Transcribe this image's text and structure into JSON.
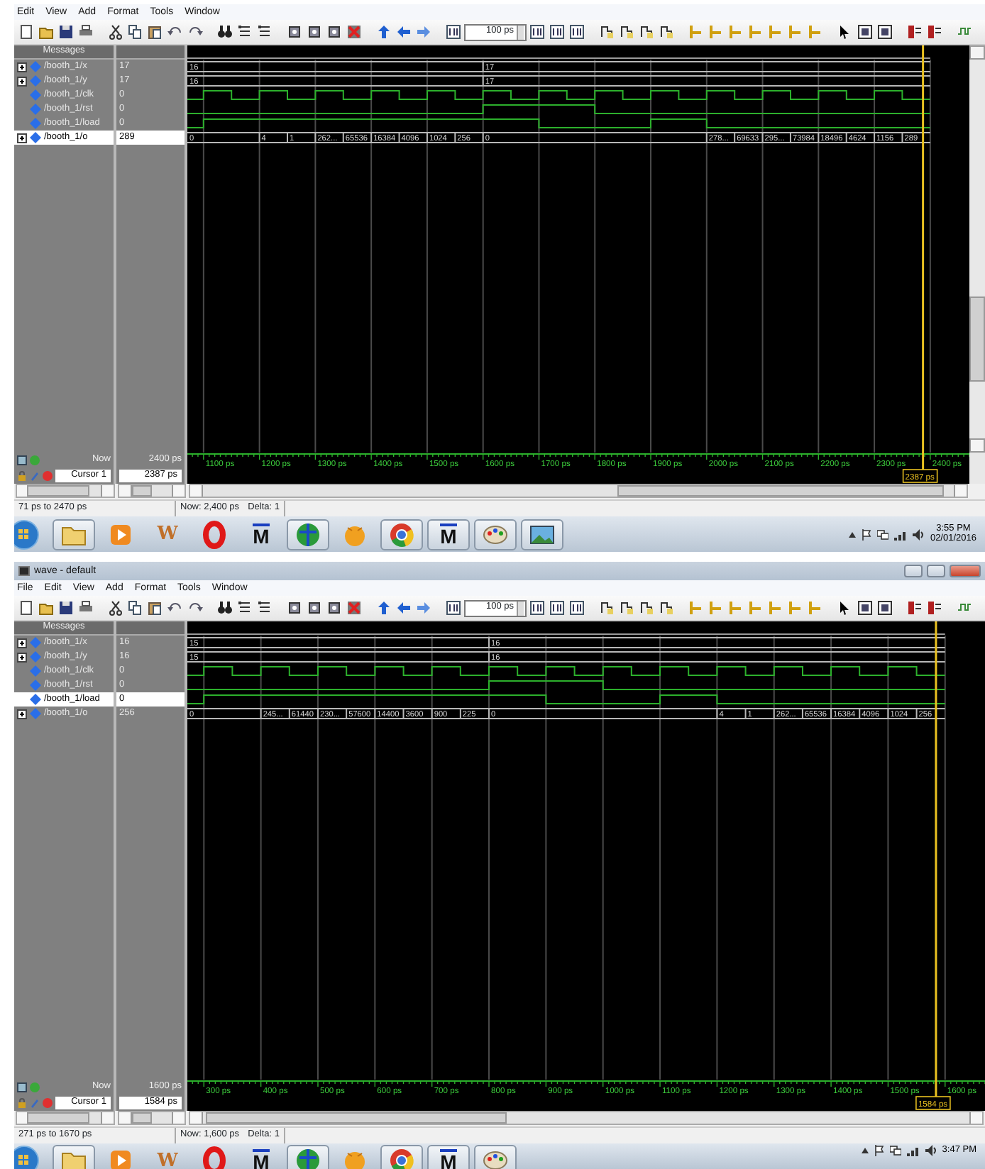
{
  "windows": [
    {
      "menu": [
        "Edit",
        "View",
        "Add",
        "Format",
        "Tools",
        "Window"
      ],
      "zoom_field": "100 ps",
      "messages_header": "Messages",
      "vertical_scrollbar": true,
      "signals": [
        {
          "name": "/booth_1/x",
          "value": "17",
          "kind": "bus",
          "expandable": true,
          "selected": false,
          "segments": [
            "16",
            "17"
          ]
        },
        {
          "name": "/booth_1/y",
          "value": "17",
          "kind": "bus",
          "expandable": true,
          "selected": false,
          "segments": [
            "16",
            "17"
          ]
        },
        {
          "name": "/booth_1/clk",
          "value": "0",
          "kind": "bit",
          "expandable": false,
          "selected": false
        },
        {
          "name": "/booth_1/rst",
          "value": "0",
          "kind": "bit",
          "expandable": false,
          "selected": false
        },
        {
          "name": "/booth_1/load",
          "value": "0",
          "kind": "bit",
          "expandable": false,
          "selected": false
        },
        {
          "name": "/booth_1/o",
          "value": "289",
          "kind": "bus",
          "expandable": true,
          "selected": true,
          "segments": [
            "0",
            "4",
            "1",
            "262...",
            "65536",
            "16384",
            "4096",
            "1024",
            "256",
            "0",
            "278...",
            "69633",
            "295...",
            "73984",
            "18496",
            "4624",
            "1156",
            "289"
          ]
        }
      ],
      "now": {
        "label": "Now",
        "value": "2400 ps"
      },
      "cursor": {
        "label": "Cursor 1",
        "value": "2387 ps",
        "flag": "2387 ps"
      },
      "ruler": [
        "1100 ps",
        "1200 ps",
        "1300 ps",
        "1400 ps",
        "1500 ps",
        "1600 ps",
        "1700 ps",
        "1800 ps",
        "1900 ps",
        "2000 ps",
        "2100 ps",
        "2200 ps",
        "2300 ps",
        "2400 ps"
      ],
      "status": {
        "range": "71 ps to 2470 ps",
        "now": "Now: 2,400 ps",
        "delta": "Delta: 1"
      },
      "taskbar": {
        "apps": [
          {
            "kind": "start",
            "running": false
          },
          {
            "kind": "folder",
            "running": true
          },
          {
            "kind": "media",
            "running": false
          },
          {
            "kind": "word",
            "label": "W",
            "running": false
          },
          {
            "kind": "opera",
            "running": false
          },
          {
            "kind": "modelsim",
            "label": "M",
            "running": false
          },
          {
            "kind": "globe",
            "running": true
          },
          {
            "kind": "ball",
            "running": false
          },
          {
            "kind": "chrome",
            "running": true
          },
          {
            "kind": "modelsim",
            "label": "M",
            "running": true
          },
          {
            "kind": "paint",
            "running": true
          },
          {
            "kind": "photo",
            "running": true
          }
        ],
        "time": "3:55 PM",
        "date": "02/01/2016"
      }
    },
    {
      "title": "wave - default",
      "menu": [
        "File",
        "Edit",
        "View",
        "Add",
        "Format",
        "Tools",
        "Window"
      ],
      "zoom_field": "100 ps",
      "messages_header": "Messages",
      "signals": [
        {
          "name": "/booth_1/x",
          "value": "16",
          "kind": "bus",
          "expandable": true,
          "selected": false,
          "segments": [
            "15",
            "16"
          ]
        },
        {
          "name": "/booth_1/y",
          "value": "16",
          "kind": "bus",
          "expandable": true,
          "selected": false,
          "segments": [
            "15",
            "16"
          ]
        },
        {
          "name": "/booth_1/clk",
          "value": "0",
          "kind": "bit",
          "expandable": false,
          "selected": false
        },
        {
          "name": "/booth_1/rst",
          "value": "0",
          "kind": "bit",
          "expandable": false,
          "selected": false
        },
        {
          "name": "/booth_1/load",
          "value": "0",
          "kind": "bit",
          "expandable": false,
          "selected": true
        },
        {
          "name": "/booth_1/o",
          "value": "256",
          "kind": "bus",
          "expandable": true,
          "selected": false,
          "segments": [
            "0",
            "245...",
            "61440",
            "230...",
            "57600",
            "14400",
            "3600",
            "900",
            "225",
            "0",
            "4",
            "1",
            "262...",
            "65536",
            "16384",
            "4096",
            "1024",
            "256"
          ]
        }
      ],
      "now": {
        "label": "Now",
        "value": "1600 ps"
      },
      "cursor": {
        "label": "Cursor 1",
        "value": "1584 ps",
        "flag": "1584 ps"
      },
      "ruler": [
        "300 ps",
        "400 ps",
        "500 ps",
        "600 ps",
        "700 ps",
        "800 ps",
        "900 ps",
        "1000 ps",
        "1100 ps",
        "1200 ps",
        "1300 ps",
        "1400 ps",
        "1500 ps",
        "1600 ps"
      ],
      "status": {
        "range": "271 ps to 1670 ps",
        "now": "Now: 1,600 ps",
        "delta": "Delta: 1"
      },
      "taskbar": {
        "apps": [
          {
            "kind": "start",
            "running": false
          },
          {
            "kind": "folder",
            "running": true
          },
          {
            "kind": "media",
            "running": false
          },
          {
            "kind": "word",
            "label": "W",
            "running": false
          },
          {
            "kind": "opera",
            "running": false
          },
          {
            "kind": "modelsim",
            "label": "M",
            "running": false
          },
          {
            "kind": "globe",
            "running": true
          },
          {
            "kind": "ball",
            "running": false
          },
          {
            "kind": "chrome",
            "running": true
          },
          {
            "kind": "modelsim",
            "label": "M",
            "running": true
          },
          {
            "kind": "paint",
            "running": true
          }
        ],
        "time": "3:47 PM"
      }
    }
  ]
}
